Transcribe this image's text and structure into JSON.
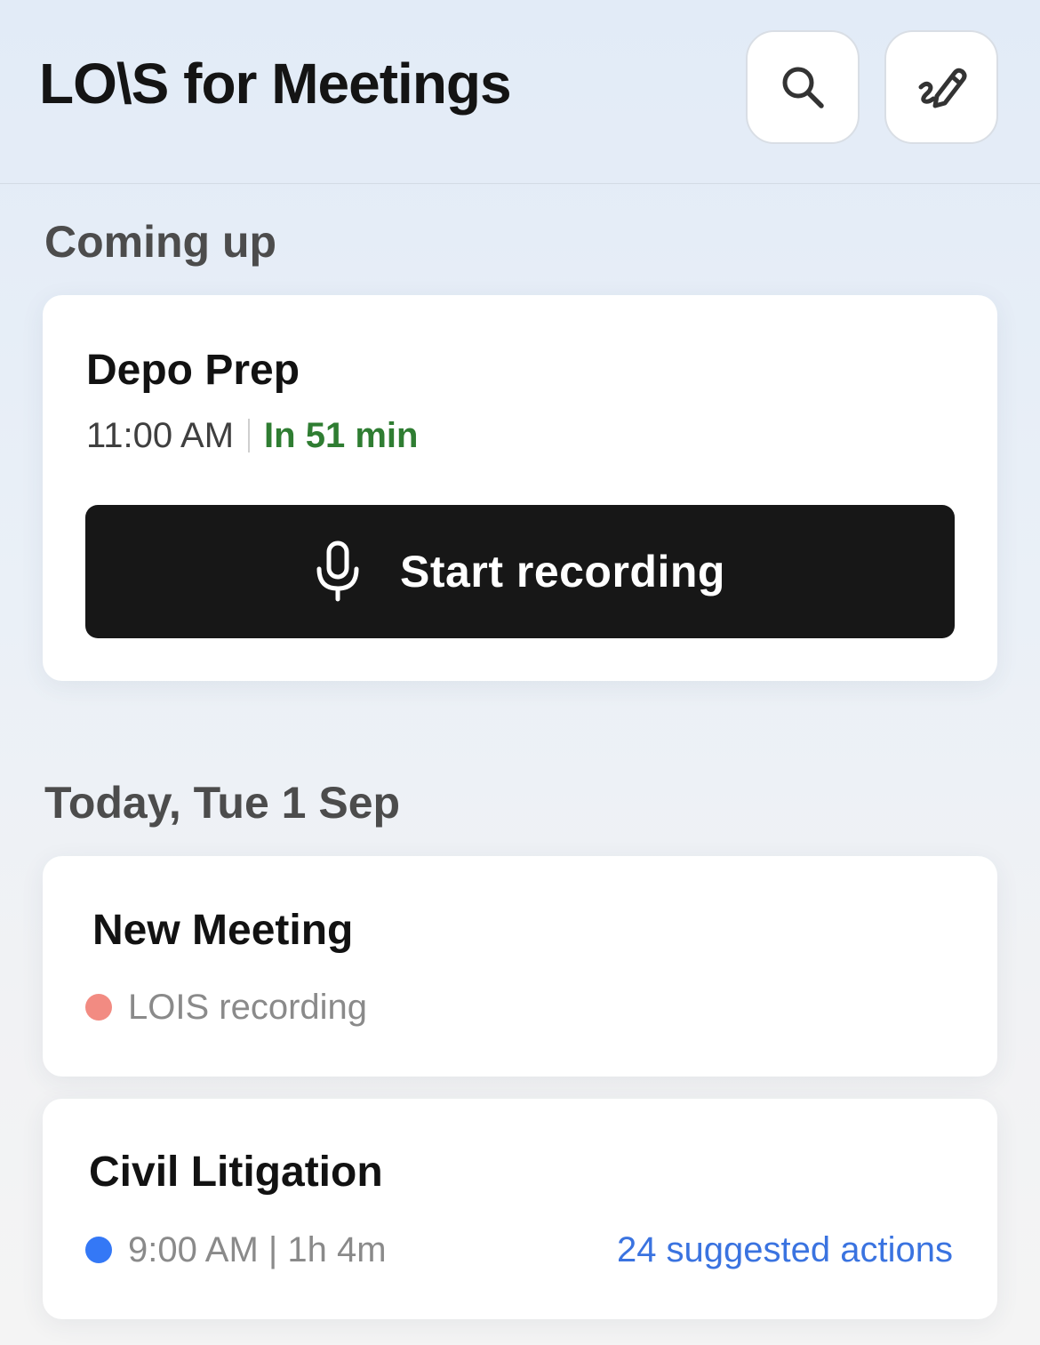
{
  "header": {
    "brand": "LO\\S for Meetings",
    "search_icon": "search-icon",
    "compose_icon": "compose-icon"
  },
  "sections": {
    "coming_up": "Coming up",
    "today": "Today, Tue 1 Sep"
  },
  "upcoming": {
    "title": "Depo Prep",
    "time": "11:00 AM",
    "countdown": "In 51 min",
    "record_label": "Start recording",
    "record_icon": "microphone-icon"
  },
  "meetings": [
    {
      "title": "New Meeting",
      "status": "LOIS recording",
      "status_color": "#f28b82"
    },
    {
      "title": "Civil Litigation",
      "status": "9:00 AM | 1h 4m",
      "status_color": "#3478f6",
      "actions": "24 suggested actions"
    }
  ],
  "colors": {
    "accent_green": "#2f7d32",
    "link_blue": "#3a73e0",
    "button_dark": "#171717"
  }
}
